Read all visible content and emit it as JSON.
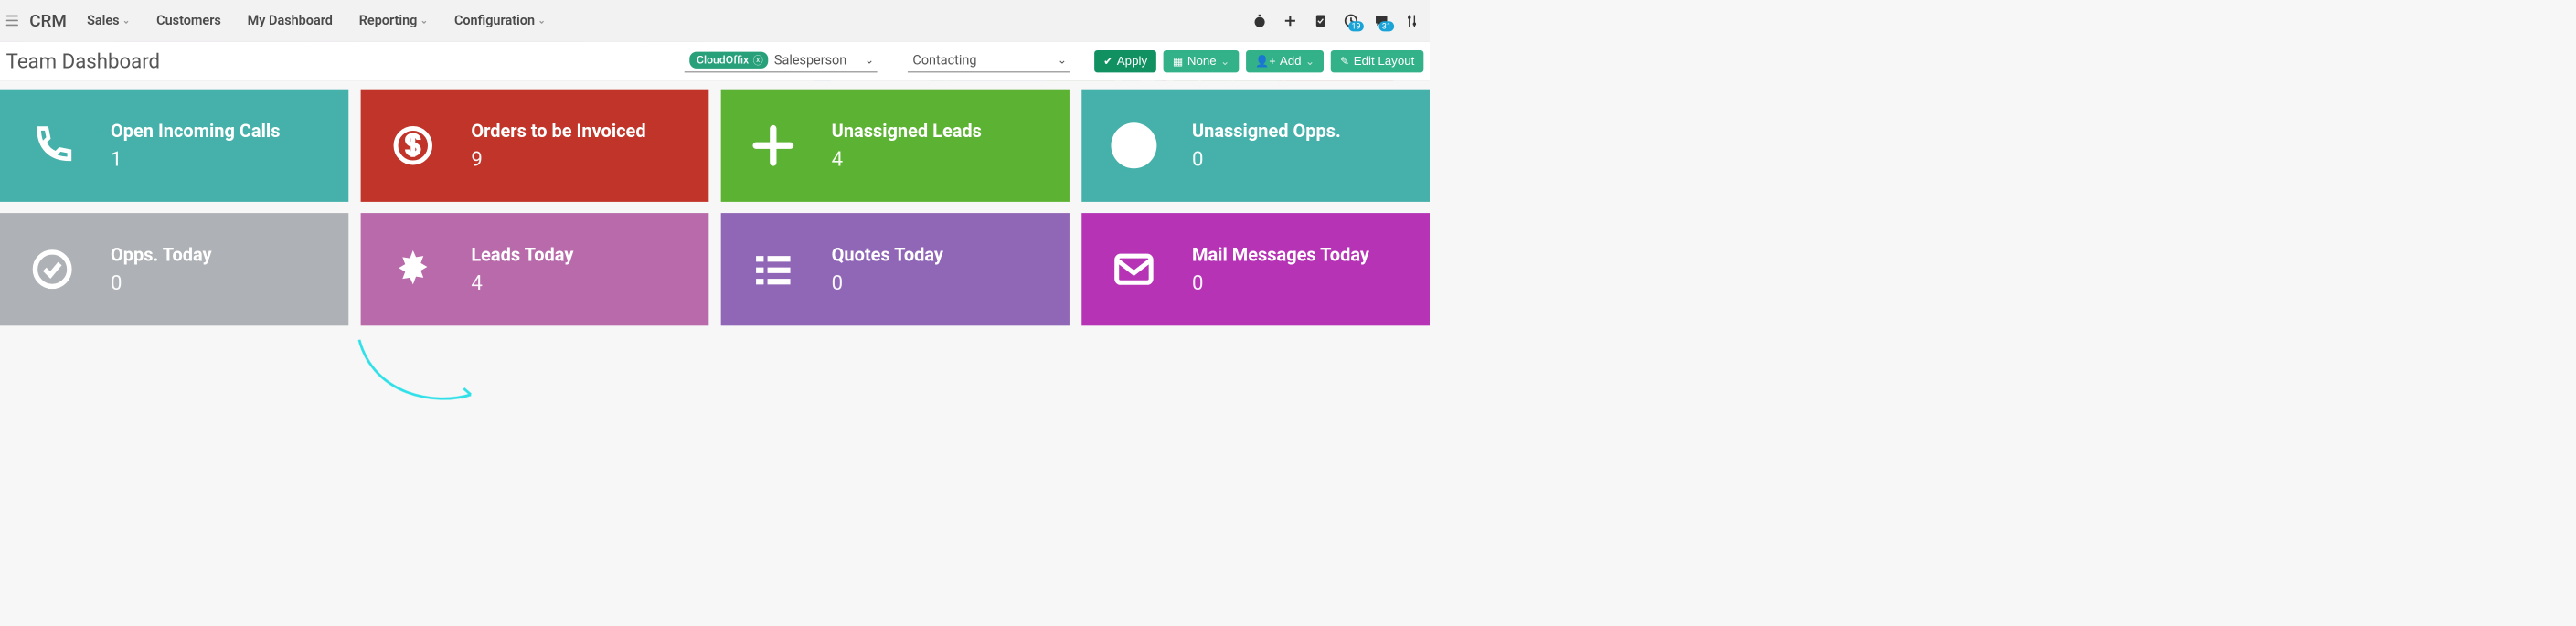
{
  "app": {
    "brand": "CRM",
    "page_title": "Team Dashboard"
  },
  "nav": {
    "items": [
      {
        "label": "Sales",
        "has_dropdown": true
      },
      {
        "label": "Customers",
        "has_dropdown": false
      },
      {
        "label": "My Dashboard",
        "has_dropdown": false
      },
      {
        "label": "Reporting",
        "has_dropdown": true
      },
      {
        "label": "Configuration",
        "has_dropdown": true
      }
    ]
  },
  "topbar_icons": {
    "badges": {
      "clock": "19",
      "chat": "31"
    }
  },
  "filters": {
    "chip": "CloudOffix",
    "salesperson_label": "Salesperson",
    "contacting_value": "Contacting"
  },
  "buttons": {
    "apply": "Apply",
    "none": "None",
    "add": "Add",
    "edit_layout": "Edit Layout"
  },
  "cards": [
    {
      "title": "Open Incoming Calls",
      "value": "1",
      "color": "c-teal",
      "icon": "phone"
    },
    {
      "title": "Orders to be Invoiced",
      "value": "9",
      "color": "c-red",
      "icon": "dollar"
    },
    {
      "title": "Unassigned Leads",
      "value": "4",
      "color": "c-green",
      "icon": "plus"
    },
    {
      "title": "Unassigned Opps.",
      "value": "0",
      "color": "c-teal2",
      "icon": "circle"
    },
    {
      "title": "Opps. Today",
      "value": "0",
      "color": "c-grey",
      "icon": "check"
    },
    {
      "title": "Leads Today",
      "value": "4",
      "color": "c-plum",
      "icon": "burst"
    },
    {
      "title": "Quotes Today",
      "value": "0",
      "color": "c-violet",
      "icon": "list"
    },
    {
      "title": "Mail Messages Today",
      "value": "0",
      "color": "c-magenta",
      "icon": "mail"
    }
  ]
}
